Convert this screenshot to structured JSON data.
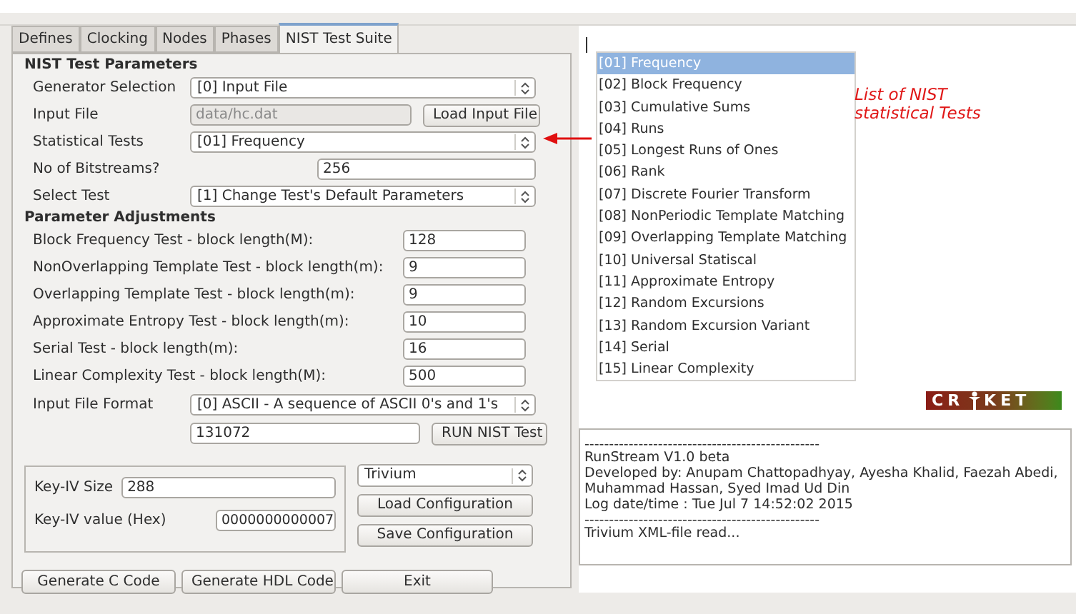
{
  "tabs": [
    {
      "label": "Defines",
      "selected": false
    },
    {
      "label": "Clocking",
      "selected": false
    },
    {
      "label": "Nodes",
      "selected": false
    },
    {
      "label": "Phases",
      "selected": false
    },
    {
      "label": "NIST Test Suite",
      "selected": true
    }
  ],
  "nist_test_parameters": {
    "title": "NIST Test Parameters",
    "rows": [
      {
        "kind": "combo",
        "label": "Generator Selection",
        "value": "[0] Input File"
      },
      {
        "kind": "file",
        "label": "Input File",
        "value": "data/hc.dat",
        "disabled": true,
        "button": "Load Input File"
      },
      {
        "kind": "combo",
        "label": "Statistical Tests",
        "value": "[01] Frequency"
      },
      {
        "kind": "number",
        "label": "No of Bitstreams?",
        "value": "256"
      },
      {
        "kind": "combo",
        "label": "Select Test",
        "value": "[1] Change Test's Default Parameters"
      }
    ]
  },
  "parameter_adjustments": {
    "title": "Parameter Adjustments",
    "fields": [
      {
        "label": "Block Frequency Test - block length(M):",
        "value": "128"
      },
      {
        "label": "NonOverlapping Template Test - block length(m):",
        "value": "9"
      },
      {
        "label": "Overlapping Template Test - block length(m):",
        "value": "9"
      },
      {
        "label": "Approximate Entropy Test - block length(m):",
        "value": "10"
      },
      {
        "label": "Serial Test - block length(m):",
        "value": "16"
      },
      {
        "label": "Linear Complexity Test - block length(M):",
        "value": "500"
      }
    ],
    "input_file_format": {
      "label": "Input File Format",
      "value": "[0] ASCII - A sequence of ASCII 0's and 1's"
    },
    "sequence_length": "131072",
    "run_button": "RUN NIST Test"
  },
  "key_iv": {
    "size_label": "Key-IV Size",
    "size_value": "288",
    "hex_label": "Key-IV value (Hex)",
    "hex_value": "0000000000007"
  },
  "cipher_select": "Trivium",
  "config_buttons": [
    "Load Configuration",
    "Save Configuration"
  ],
  "bottom_buttons": [
    "Generate C Code",
    "Generate HDL Code",
    "Exit"
  ],
  "test_list": [
    {
      "label": "[01] Frequency",
      "selected": true
    },
    {
      "label": "[02] Block Frequency",
      "selected": false
    },
    {
      "label": "[03] Cumulative Sums",
      "selected": false
    },
    {
      "label": "[04] Runs",
      "selected": false
    },
    {
      "label": "[05] Longest Runs of Ones",
      "selected": false
    },
    {
      "label": "[06] Rank",
      "selected": false
    },
    {
      "label": "[07] Discrete Fourier Transform",
      "selected": false
    },
    {
      "label": "[08] NonPeriodic Template Matching",
      "selected": false
    },
    {
      "label": "[09] Overlapping Template Matching",
      "selected": false
    },
    {
      "label": "[10] Universal Statiscal",
      "selected": false
    },
    {
      "label": "[11] Approximate Entropy",
      "selected": false
    },
    {
      "label": "[12] Random Excursions",
      "selected": false
    },
    {
      "label": "[13] Random Excursion Variant",
      "selected": false
    },
    {
      "label": "[14] Serial",
      "selected": false
    },
    {
      "label": "[15] Linear Complexity",
      "selected": false
    }
  ],
  "annotation": "List of NIST statistical Tests",
  "logo": {
    "left": "CR",
    "right": "KET"
  },
  "log": [
    "------------------------------------------------",
    "RunStream V1.0 beta",
    "Developed by: Anupam Chattopadhyay, Ayesha Khalid, Faezah Abedi,",
    "Muhammad Hassan, Syed Imad Ud Din",
    "Log date/time : Tue Jul 7 14:52:02 2015",
    "------------------------------------------------",
    "Trivium XML-file read..."
  ]
}
